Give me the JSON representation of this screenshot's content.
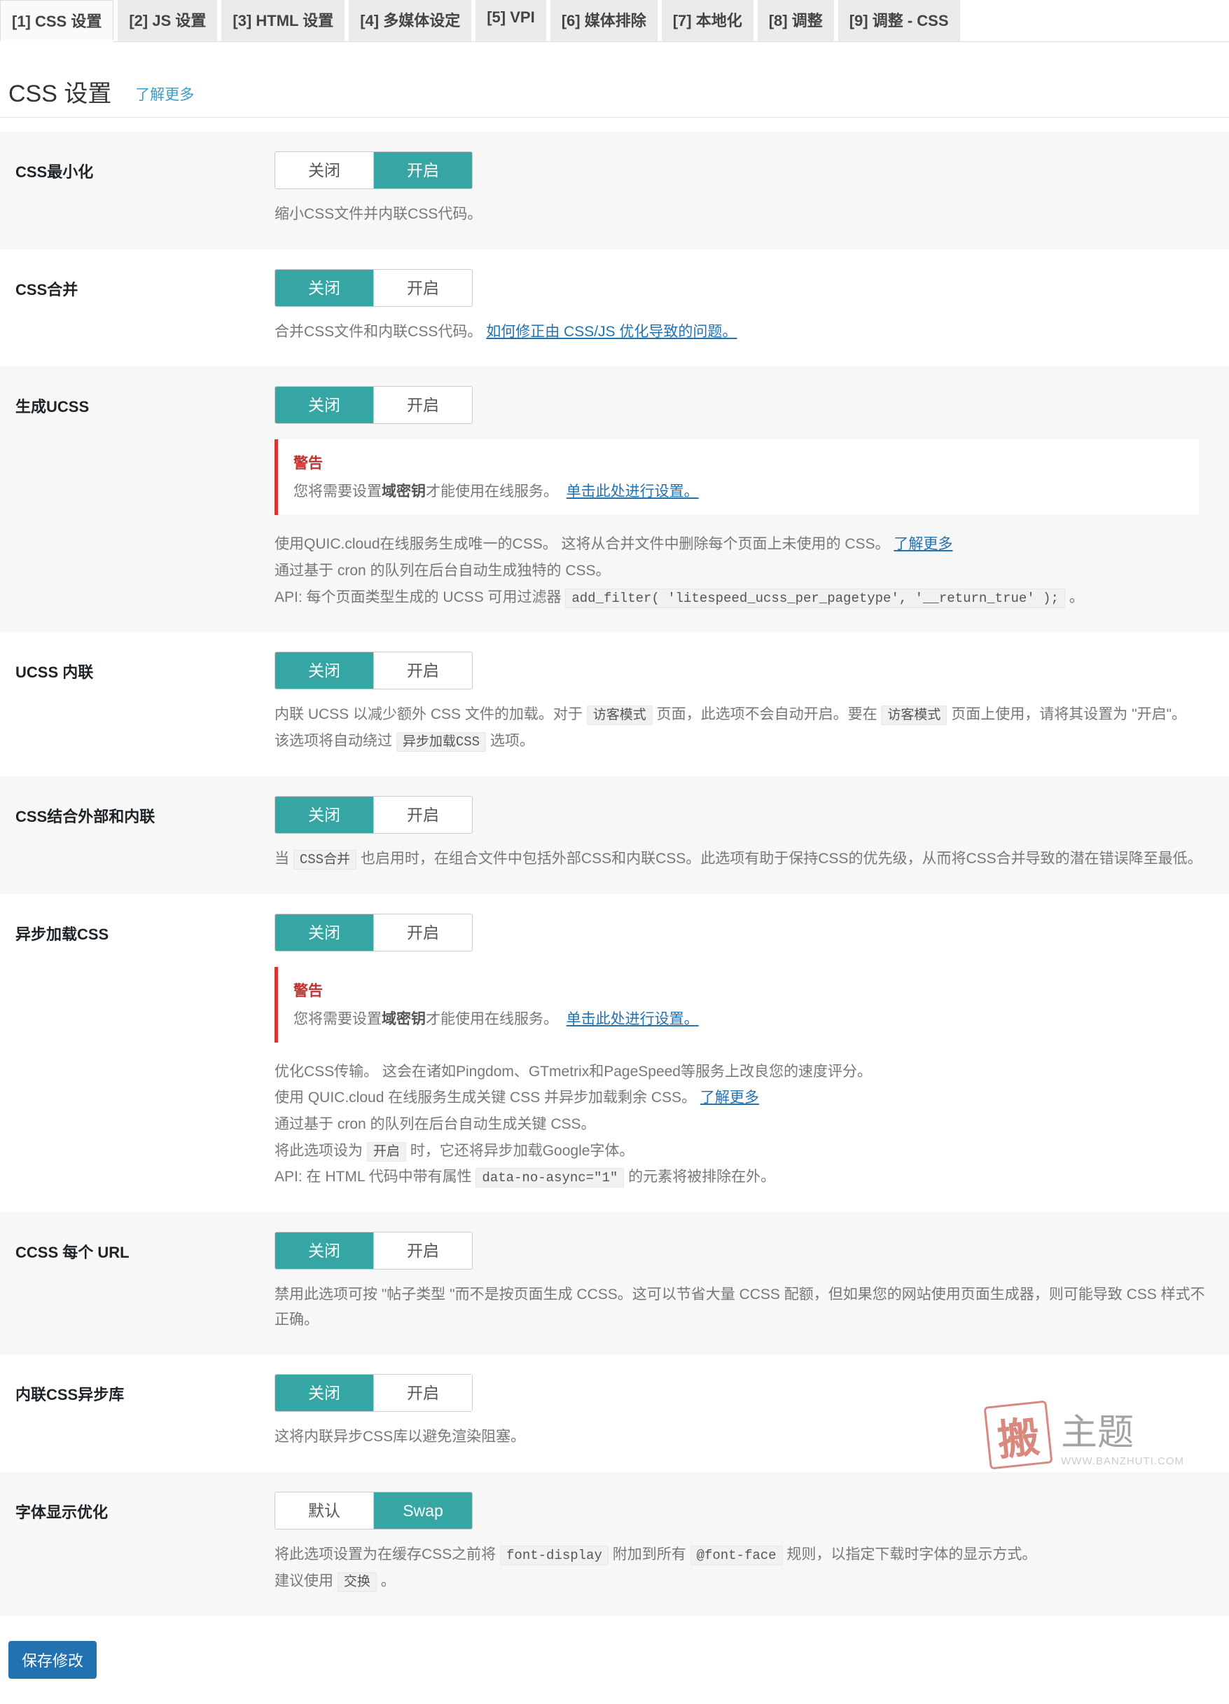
{
  "tabs": {
    "items": [
      "[1] CSS 设置",
      "[2] JS 设置",
      "[3] HTML 设置",
      "[4] 多媒体设定",
      "[5] VPI",
      "[6] 媒体排除",
      "[7] 本地化",
      "[8] 调整",
      "[9] 调整 - CSS"
    ],
    "active_index": 0
  },
  "header": {
    "title": "CSS 设置",
    "learn_more": "了解更多"
  },
  "toggle_labels": {
    "off": "关闭",
    "on": "开启",
    "default": "默认",
    "swap": "Swap"
  },
  "warning": {
    "title": "警告",
    "body_prefix": "您将需要设置",
    "body_bold": "域密钥",
    "body_suffix": "才能使用在线服务。",
    "link": "单击此处进行设置。"
  },
  "settings": {
    "css_min": {
      "label": "CSS最小化",
      "state": "on",
      "desc": "缩小CSS文件并内联CSS代码。"
    },
    "css_combine": {
      "label": "CSS合并",
      "state": "off",
      "desc_prefix": "合并CSS文件和内联CSS代码。",
      "desc_link": "如何修正由 CSS/JS 优化导致的问题。"
    },
    "ucss": {
      "label": "生成UCSS",
      "state": "off",
      "show_warning": true,
      "l1_prefix": "使用QUIC.cloud在线服务生成唯一的CSS。 这将从合并文件中删除每个页面上未使用的 CSS。",
      "l1_link": "了解更多",
      "l2": "通过基于 cron 的队列在后台自动生成独特的 CSS。",
      "l3_prefix": "API: 每个页面类型生成的 UCSS 可用过滤器",
      "l3_code": "add_filter( 'litespeed_ucss_per_pagetype', '__return_true' );",
      "l3_suffix": "。"
    },
    "ucss_inline": {
      "label": "UCSS 内联",
      "state": "off",
      "l1_a": "内联 UCSS 以减少额外 CSS 文件的加载。对于",
      "l1_code1": "访客模式",
      "l1_b": "页面，此选项不会自动开启。要在",
      "l1_code2": "访客模式",
      "l1_c": "页面上使用，请将其设置为 \"开启\"。",
      "l2_a": "该选项将自动绕过",
      "l2_code": "异步加载CSS",
      "l2_b": "选项。"
    },
    "css_ext_inline": {
      "label": "CSS结合外部和内联",
      "state": "off",
      "l1_a": "当",
      "l1_code": "CSS合并",
      "l1_b": "也启用时，在组合文件中包括外部CSS和内联CSS。此选项有助于保持CSS的优先级，从而将CSS合并导致的潜在错误降至最低。"
    },
    "css_async": {
      "label": "异步加载CSS",
      "state": "off",
      "show_warning": true,
      "l1": "优化CSS传输。 这会在诸如Pingdom、GTmetrix和PageSpeed等服务上改良您的速度评分。",
      "l2_a": "使用 QUIC.cloud 在线服务生成关键 CSS 并异步加载剩余 CSS。",
      "l2_link": "了解更多",
      "l3": "通过基于 cron 的队列在后台自动生成关键 CSS。",
      "l4_a": "将此选项设为",
      "l4_code": "开启",
      "l4_b": "时，它还将异步加载Google字体。",
      "l5_a": "API: 在 HTML 代码中带有属性",
      "l5_code": "data-no-async=\"1\"",
      "l5_b": "的元素将被排除在外。"
    },
    "ccss_per_url": {
      "label": "CCSS 每个 URL",
      "state": "off",
      "desc": "禁用此选项可按 \"帖子类型 \"而不是按页面生成 CCSS。这可以节省大量 CCSS 配额，但如果您的网站使用页面生成器，则可能导致 CSS 样式不正确。"
    },
    "inline_css_async": {
      "label": "内联CSS异步库",
      "state": "off",
      "desc": "这将内联异步CSS库以避免渲染阻塞。"
    },
    "font_display": {
      "label": "字体显示优化",
      "state": "swap",
      "l1_a": "将此选项设置为在缓存CSS之前将",
      "l1_code1": "font-display",
      "l1_b": "附加到所有",
      "l1_code2": "@font-face",
      "l1_c": "规则，以指定下载时字体的显示方式。",
      "l2_a": "建议使用",
      "l2_code": "交换",
      "l2_b": "。"
    }
  },
  "save_label": "保存修改",
  "watermark": {
    "stamp": "搬",
    "main": "主题",
    "sub": "WWW.BANZHUTI.COM"
  }
}
